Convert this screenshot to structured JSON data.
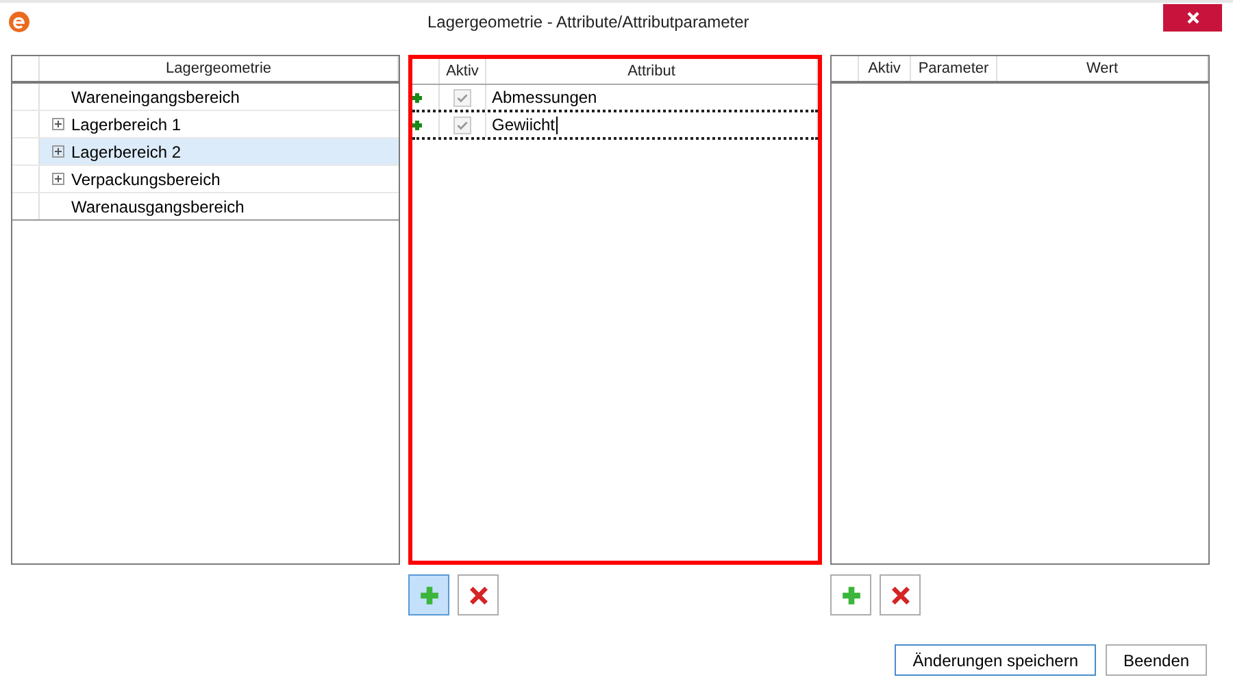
{
  "window": {
    "title": "Lagergeometrie - Attribute/Attributparameter"
  },
  "geometry": {
    "column": "Lagergeometrie",
    "items": [
      {
        "label": "Wareneingangsbereich",
        "has_children": false,
        "selected": false
      },
      {
        "label": "Lagerbereich 1",
        "has_children": true,
        "selected": false
      },
      {
        "label": "Lagerbereich 2",
        "has_children": true,
        "selected": true
      },
      {
        "label": "Verpackungsbereich",
        "has_children": true,
        "selected": false
      },
      {
        "label": "Warenausgangsbereich",
        "has_children": false,
        "selected": false
      }
    ]
  },
  "attributes": {
    "focused": true,
    "columns": [
      "Aktiv",
      "Attribut"
    ],
    "rows": [
      {
        "active": true,
        "name": "Abmessungen",
        "editing": false
      },
      {
        "active": true,
        "name": "Gewiicht",
        "editing": true
      }
    ]
  },
  "parameters": {
    "columns": [
      "Aktiv",
      "Parameter",
      "Wert"
    ]
  },
  "buttons": [
    "Änderungen speichern",
    "Beenden"
  ]
}
